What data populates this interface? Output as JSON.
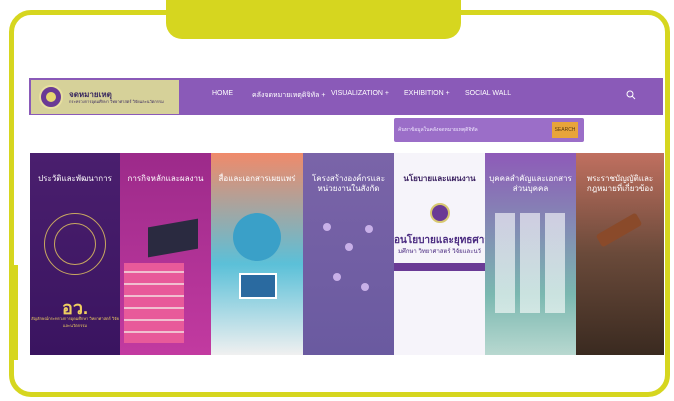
{
  "logo": {
    "title": "จดหมายเหตุ",
    "subtitle": "กระทรวงการอุดมศึกษา วิทยาศาสตร์ วิจัยและนวัตกรรม"
  },
  "nav": {
    "items": [
      "HOME",
      "คลังจดหมายเหตุดิจิทัล +",
      "VISUALIZATION +",
      "EXHIBITION +",
      "SOCIAL WALL"
    ]
  },
  "search": {
    "placeholder": "ค้นหาข้อมูลในคลังจดหมายเหตุดิจิทัล",
    "button_label": "SEARCH"
  },
  "panels": [
    {
      "title": "ประวัติและพัฒนาการ",
      "extra_big": "อว.",
      "extra_small": "สัญลักษณ์กระทรวงการอุดมศึกษา วิทยาศาสตร์ วิจัยและนวัตกรรม"
    },
    {
      "title": "การกิจหลักและผลงาน"
    },
    {
      "title": "สื่อและเอกสารเผยแพร่"
    },
    {
      "title": "โครงสร้างองค์กรและหน่วยงานในสังกัด"
    },
    {
      "title": "นโยบายและแผนงาน",
      "sub": "อนโยบายและยุทธศาส",
      "sub2": "มศึกษา วิทยาศาสตร์ วิจัยและนวั"
    },
    {
      "title": "บุคคลสำคัญและเอกสารส่วนบุคคล"
    },
    {
      "title": "พระราชบัญญัติและกฎหมายที่เกี่ยวข้อง"
    }
  ],
  "colors": {
    "frame": "#d6d61f",
    "nav": "#8a5ab8",
    "search_button": "#e8a43a"
  }
}
